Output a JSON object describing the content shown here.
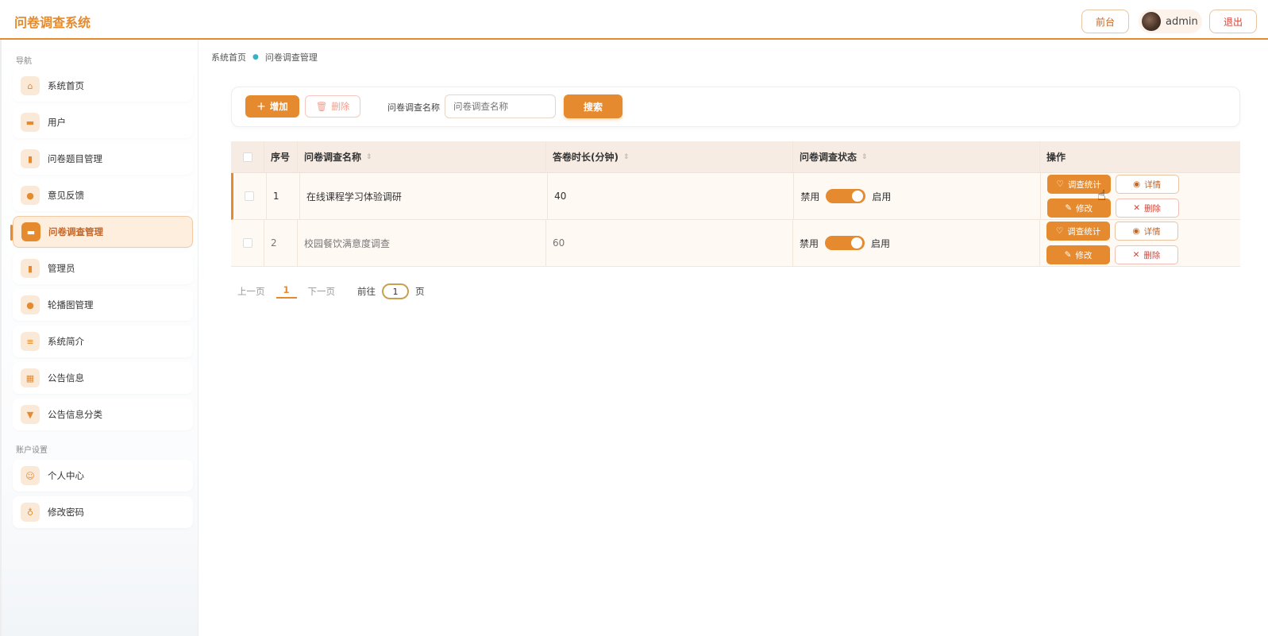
{
  "app": {
    "title": "问卷调查系统"
  },
  "header": {
    "front_label": "前台",
    "user_name": "admin",
    "logout_label": "退出"
  },
  "sidebar": {
    "nav_section": "导航",
    "items": [
      {
        "label": "系统首页",
        "icon": "home-icon"
      },
      {
        "label": "用户",
        "icon": "briefcase-icon"
      },
      {
        "label": "问卷题目管理",
        "icon": "bar-chart-icon"
      },
      {
        "label": "意见反馈",
        "icon": "balloon-icon"
      },
      {
        "label": "问卷调查管理",
        "icon": "briefcase-icon",
        "active": true
      },
      {
        "label": "管理员",
        "icon": "bar-chart-icon"
      },
      {
        "label": "轮播图管理",
        "icon": "balloon-icon"
      },
      {
        "label": "系统简介",
        "icon": "sliders-icon"
      },
      {
        "label": "公告信息",
        "icon": "grid-icon"
      },
      {
        "label": "公告信息分类",
        "icon": "stamp-icon"
      }
    ],
    "account_section": "账户设置",
    "account_items": [
      {
        "label": "个人中心",
        "icon": "user-icon"
      },
      {
        "label": "修改密码",
        "icon": "thermometer-icon"
      }
    ]
  },
  "breadcrumb": {
    "home": "系统首页",
    "current": "问卷调查管理"
  },
  "toolbar": {
    "add_label": "增加",
    "delete_label": "删除",
    "search_label": "问卷调查名称",
    "search_placeholder": "问卷调查名称",
    "search_button": "搜索"
  },
  "table": {
    "headers": {
      "no": "序号",
      "name": "问卷调查名称",
      "duration": "答卷时长(分钟)",
      "status": "问卷调查状态",
      "ops": "操作"
    },
    "rows": [
      {
        "no": "1",
        "name": "在线课程学习体验调研",
        "duration": "40",
        "off_label": "禁用",
        "on_label": "启用"
      },
      {
        "no": "2",
        "name": "校园餐饮满意度调查",
        "duration": "60",
        "off_label": "禁用",
        "on_label": "启用"
      }
    ],
    "op_labels": {
      "stats": "调查统计",
      "detail": "详情",
      "edit": "修改",
      "delete": "删除"
    }
  },
  "pagination": {
    "prev": "上一页",
    "current": "1",
    "next": "下一页",
    "goto_label": "前往",
    "goto_value": "1",
    "unit": "页"
  },
  "colors": {
    "accent": "#e58a2e",
    "danger": "#d0453a"
  }
}
